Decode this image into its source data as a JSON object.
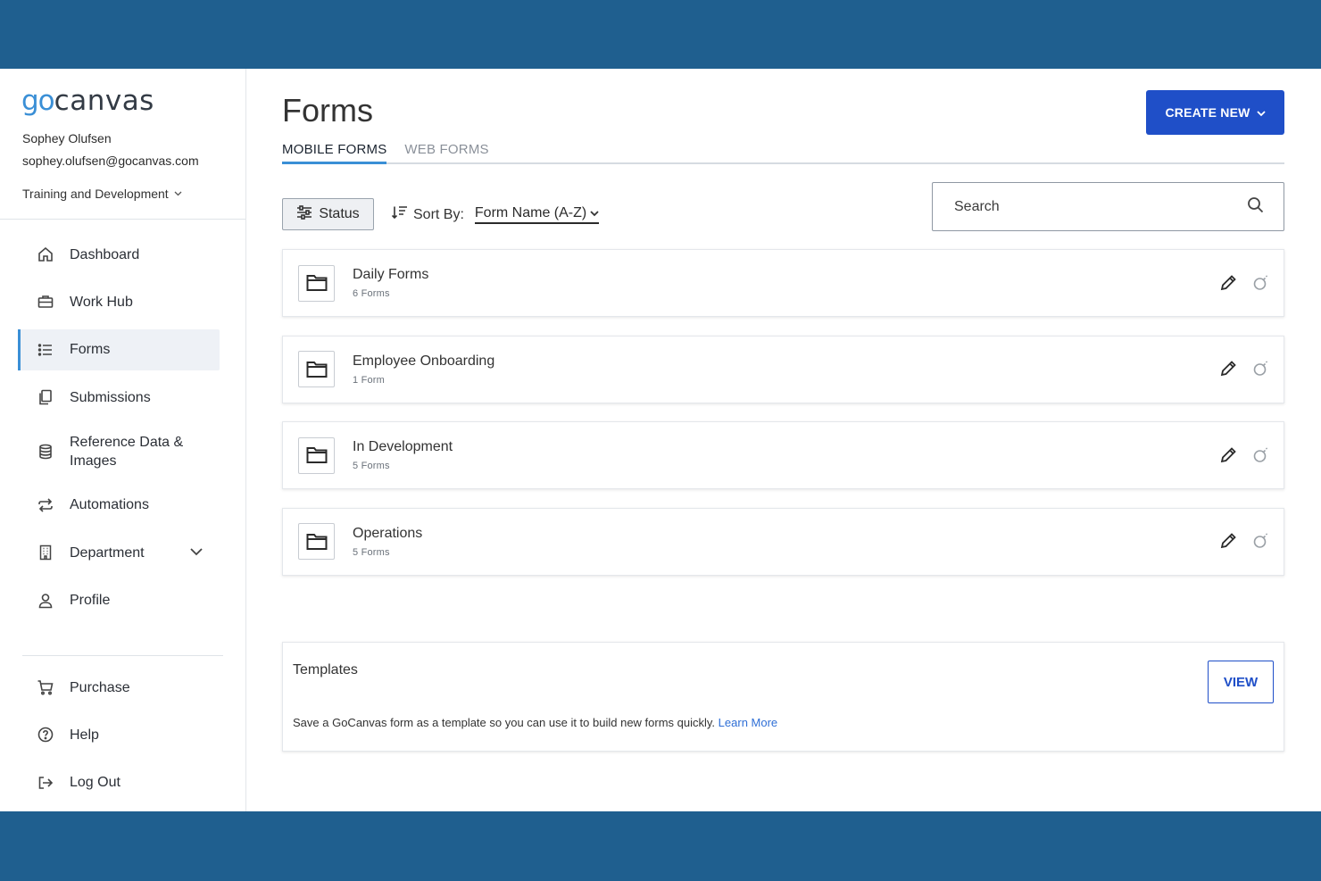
{
  "brand": {
    "go": "go",
    "canvas": "canvas"
  },
  "user": {
    "name": "Sophey Olufsen",
    "email": "sophey.olufsen@gocanvas.com",
    "department": "Training and Development"
  },
  "nav": {
    "items": [
      {
        "label": "Dashboard",
        "icon": "home-icon"
      },
      {
        "label": "Work Hub",
        "icon": "briefcase-icon"
      },
      {
        "label": "Forms",
        "icon": "list-icon"
      },
      {
        "label": "Submissions",
        "icon": "documents-icon"
      },
      {
        "label": "Reference Data & Images",
        "icon": "database-icon"
      },
      {
        "label": "Automations",
        "icon": "repeat-icon"
      },
      {
        "label": "Department",
        "icon": "building-icon"
      },
      {
        "label": "Profile",
        "icon": "user-icon"
      }
    ],
    "secondary": [
      {
        "label": "Purchase",
        "icon": "cart-icon"
      },
      {
        "label": "Help",
        "icon": "help-icon"
      },
      {
        "label": "Log Out",
        "icon": "logout-icon"
      }
    ],
    "active": "Forms"
  },
  "page": {
    "title": "Forms",
    "create_label": "CREATE NEW",
    "tabs": [
      {
        "label": "MOBILE FORMS",
        "active": true
      },
      {
        "label": "WEB FORMS",
        "active": false
      }
    ],
    "status_label": "Status",
    "sort_label": "Sort By:",
    "sort_value": "Form Name (A-Z)",
    "search_placeholder": "Search"
  },
  "folders": [
    {
      "name": "Daily Forms",
      "count": "6 Forms"
    },
    {
      "name": "Employee Onboarding",
      "count": "1 Form"
    },
    {
      "name": "In Development",
      "count": "5 Forms"
    },
    {
      "name": "Operations",
      "count": "5 Forms"
    }
  ],
  "templates": {
    "title": "Templates",
    "description": "Save a GoCanvas form as a template so you can use it to build new forms quickly.",
    "learn_more": "Learn More",
    "view_label": "VIEW"
  },
  "colors": {
    "frame": "#1f5f8f",
    "primary": "#1f4fc8",
    "accent": "#3a8fd6"
  }
}
